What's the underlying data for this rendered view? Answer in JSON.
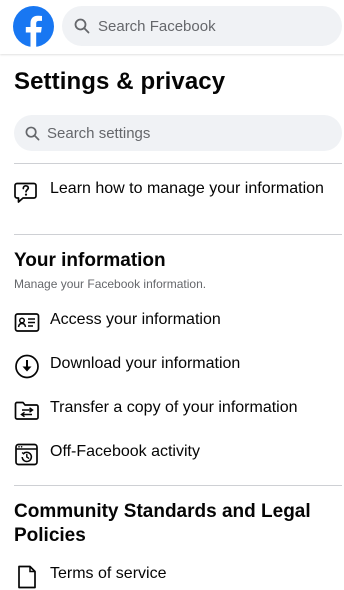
{
  "header": {
    "search_placeholder": "Search Facebook",
    "logo_icon": "facebook-logo-icon",
    "brand_color": "#1877f2"
  },
  "settings": {
    "title": "Settings & privacy",
    "search_placeholder": "Search settings",
    "manage_info_label": "Learn how to manage your information"
  },
  "your_information": {
    "title": "Your information",
    "subtitle": "Manage your Facebook information.",
    "items": [
      {
        "label": "Access your information",
        "icon": "id-card-icon"
      },
      {
        "label": "Download your information",
        "icon": "download-circle-icon"
      },
      {
        "label": "Transfer a copy of your information",
        "icon": "folder-transfer-icon"
      },
      {
        "label": "Off-Facebook activity",
        "icon": "activity-history-icon"
      }
    ]
  },
  "community": {
    "title": "Community Standards and Legal Policies",
    "items": [
      {
        "label": "Terms of service",
        "icon": "document-icon"
      }
    ]
  }
}
